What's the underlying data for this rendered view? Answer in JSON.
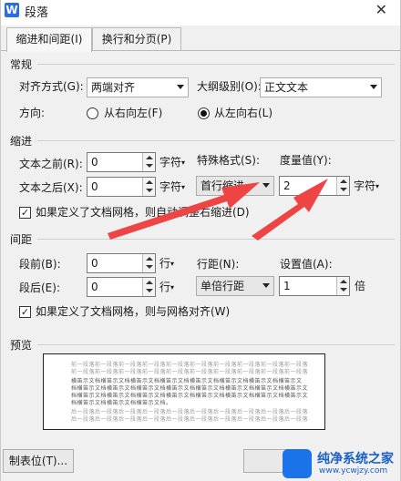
{
  "window": {
    "title": "段落",
    "app_icon": "W"
  },
  "tabs": [
    {
      "label": "缩进和间距(I)",
      "active": true
    },
    {
      "label": "换行和分页(P)",
      "active": false
    }
  ],
  "general": {
    "heading": "常规",
    "alignment_label": "对齐方式(G):",
    "alignment_value": "两端对齐",
    "outline_label": "大纲级别(O):",
    "outline_value": "正文文本",
    "direction_label": "方向:",
    "rtl_label": "从右向左(F)",
    "ltr_label": "从左向右(L)",
    "direction_selected": "ltr"
  },
  "indent": {
    "heading": "缩进",
    "before_label": "文本之前(R):",
    "before_value": "0",
    "after_label": "文本之后(X):",
    "after_value": "0",
    "unit": "字符",
    "special_label": "特殊格式(S):",
    "special_value": "首行缩进",
    "measure_label": "度量值(Y):",
    "measure_value": "2",
    "measure_unit": "字符",
    "grid_check_label": "如果定义了文档网格，则自动调整右缩进(D)",
    "grid_checked": true
  },
  "spacing": {
    "heading": "间距",
    "before_label": "段前(B):",
    "before_value": "0",
    "after_label": "段后(E):",
    "after_value": "0",
    "unit": "行",
    "line_label": "行距(N):",
    "line_value": "单倍行距",
    "set_label": "设置值(A):",
    "set_value": "1",
    "set_unit": "倍",
    "grid_check_label": "如果定义了文档网格，则与网格对齐(W)",
    "grid_checked": true
  },
  "preview": {
    "heading": "预览",
    "prev_line_1": "前一段落前一段落前一段落前一段落前一段落前一段落前一段落前一段落前一段落前一段落",
    "prev_line_2": "前一段落前一段落前一段落前一段落前一段落前一段落前一段落前一段落前一段落前一段落",
    "sample_line_1": "     横笛示文档横笛示文档横笛示文档横笛示文档横笛示文档横笛示文档横笛示文档横笛示文",
    "sample_line_2": "档横笛示文档横笛示文档横笛示文档横笛示文档横笛示文档横笛示文档横笛示文档横笛示文",
    "sample_line_3": "档横笛示文档横笛示文档横笛示文档横笛示文档横笛示文档横笛示文档横笛示文档横笛示文",
    "sample_line_4": "档横笛示文档横笛示文档横笛示文档。",
    "next_line_1": "后一段落后一段落后一段落后一段落后一段落后一段落后一段落后一段落后一段落后一段落",
    "next_line_2": "后一段落后一段落后一段落后一段落后一段落后一段落后一段落后一段落后一段落后一段落"
  },
  "footer": {
    "tabs_button": "制表位(T)..."
  },
  "watermark": {
    "title": "纯净系统之家",
    "url": "www.ycwjzy.com"
  },
  "colors": {
    "accent": "#2b6de5",
    "annotation_arrow": "#ee4444"
  }
}
